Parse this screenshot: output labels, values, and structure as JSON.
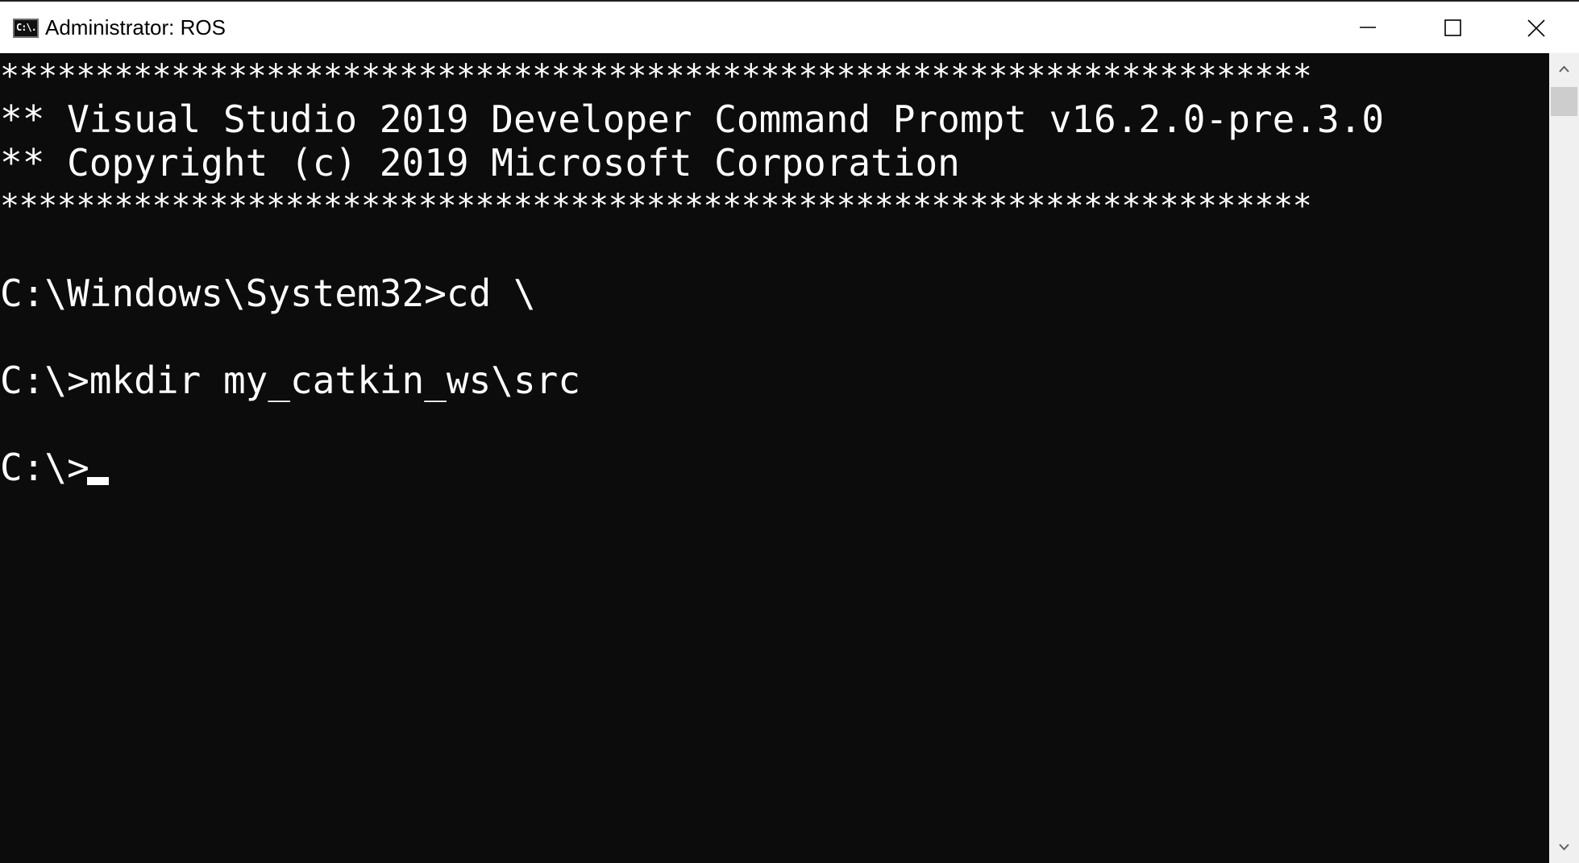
{
  "window": {
    "title": "Administrator: ROS",
    "icon_label": "C:\\."
  },
  "console": {
    "lines": [
      "*********************************************************************",
      "** Visual Studio 2019 Developer Command Prompt v16.2.0-pre.3.0",
      "** Copyright (c) 2019 Microsoft Corporation",
      "*********************************************************************",
      "C:\\Windows\\System32>cd \\",
      "C:\\>mkdir my_catkin_ws\\src",
      "C:\\>"
    ]
  },
  "icons": {
    "app": "console-icon",
    "minimize": "minimize-icon",
    "maximize": "maximize-icon",
    "close": "close-icon",
    "scroll_up": "chevron-up-icon",
    "scroll_down": "chevron-down-icon"
  },
  "colors": {
    "console_bg": "#0c0c0c",
    "console_fg": "#ffffff",
    "titlebar_bg": "#ffffff",
    "scrollbar_bg": "#f0f0f0"
  }
}
